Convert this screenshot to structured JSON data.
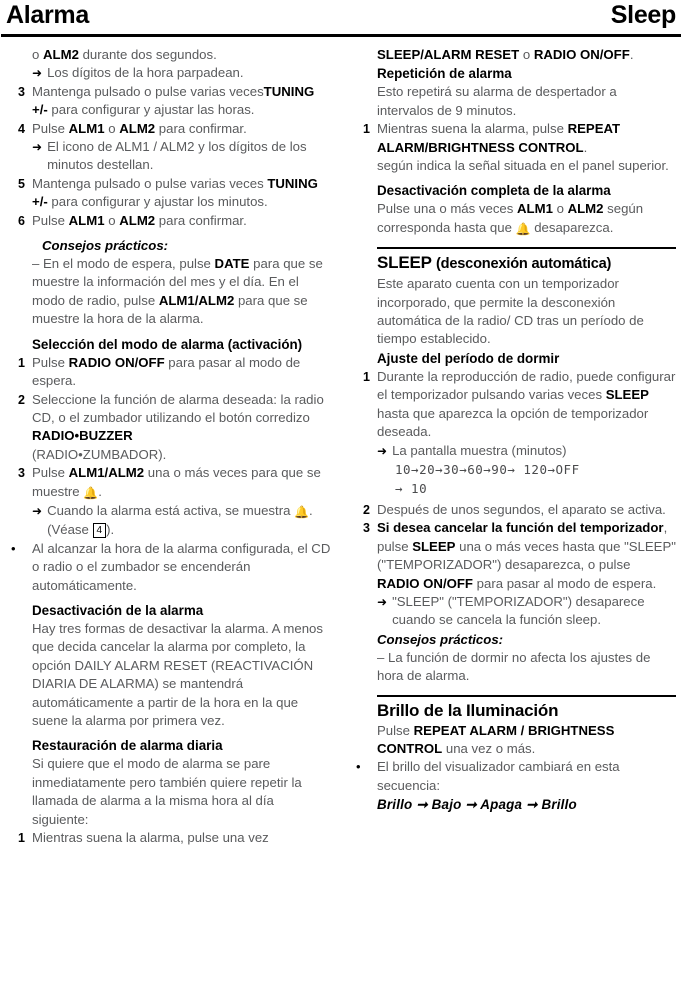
{
  "header": {
    "left_title": "Alarma",
    "right_title": "Sleep"
  },
  "left_column": {
    "item_cont_1": {
      "text_pre": "o ",
      "bold": "ALM2",
      "text_post": " durante dos segundos."
    },
    "arrow_1": "Los dígitos de la hora parpadean.",
    "step_3": {
      "num": "3",
      "text_1": "Mantenga pulsado o pulse varias veces",
      "bold_1": "TUNING +/-",
      "text_2": " para configurar y ajustar las horas."
    },
    "step_4": {
      "num": "4",
      "text_1": "Pulse ",
      "bold_1": "ALM1",
      "text_2": " o ",
      "bold_2": "ALM2",
      "text_3": " para confirmar."
    },
    "arrow_2": "El icono de ALM1 / ALM2 y los dígitos de los minutos destellan.",
    "step_5": {
      "num": "5",
      "text_1": "Mantenga pulsado o pulse varias veces ",
      "bold_1": "TUNING +/-",
      "text_2": " para configurar y ajustar los minutos."
    },
    "step_6": {
      "num": "6",
      "text_1": "Pulse ",
      "bold_1": "ALM1",
      "text_2": " o ",
      "bold_2": "ALM2",
      "text_3": " para confirmar."
    },
    "tips_title_1": "Consejos prácticos:",
    "tips_body_1": {
      "text_1": "– En el modo de espera, pulse ",
      "bold_1": "DATE",
      "text_2": " para que se muestre la información del mes y el día. En el modo de radio, pulse ",
      "bold_2": "ALM1/ALM2",
      "text_3": " para que se muestre la hora de la alarma."
    },
    "heading_seleccion": "Selección del modo de alarma (activación)",
    "step_s1": {
      "num": "1",
      "text_1": "Pulse ",
      "bold_1": "RADIO ON/OFF",
      "text_2": " para pasar al modo de espera."
    },
    "step_s2": {
      "num": "2",
      "text_1": "Seleccione la función de alarma deseada: la radio CD, o el zumbador utilizando el botón corredizo ",
      "bold_1": "RADIO•BUZZER",
      "text_2": " (RADIO•ZUMBADOR)."
    },
    "step_s3": {
      "num": "3",
      "text_1": "Pulse ",
      "bold_1": "ALM1/ALM2",
      "text_2": " una o más veces para que se muestre ",
      "icon": "bell-icon",
      "text_3": "."
    },
    "arrow_s3": {
      "text_1": "Cuando la alarma está activa, se muestra ",
      "icon": "bell-icon",
      "text_2": ". (Véase ",
      "boxnum": "4",
      "text_3": ")."
    },
    "bullet_s": {
      "marker": "•",
      "text": "Al alcanzar la hora de la alarma configurada, el CD o radio o el zumbador se encenderán automáticamente."
    },
    "heading_desactivacion": "Desactivación de la alarma",
    "body_desactivacion": "Hay tres formas de desactivar la alarma.  A menos que decida cancelar la alarma por completo, la opción DAILY ALARM RESET (REACTIVACIÓN DIARIA DE ALARMA) se mantendrá automáticamente a partir de la hora en la que suene la alarma por primera vez.",
    "heading_restauracion": "Restauración de alarma diaria",
    "body_restauracion": "Si quiere que el modo de alarma se pare inmediatamente pero también quiere repetir la llamada de alarma a la misma hora al día siguiente:",
    "step_r1": {
      "num": "1",
      "text_1": "Mientras suena la alarma, pulse una vez"
    }
  },
  "right_column": {
    "cont_top": {
      "bold_1": "SLEEP/ALARM RESET",
      "text_1": " o ",
      "bold_2": "RADIO ON/OFF",
      "text_2": "."
    },
    "heading_repeticion": "Repetición de alarma",
    "body_repeticion": "Esto repetirá su alarma de despertador a intervalos de 9 minutos.",
    "step_rp1": {
      "num": "1",
      "text_1": "Mientras suena la alarma, pulse ",
      "bold_1": "REPEAT ALARM/BRIGHTNESS CONTROL",
      "text_2": "."
    },
    "body_rp1_cont": "según indica la señal situada en el panel superior.",
    "heading_desact_completa": "Desactivación completa de la alarma",
    "body_desact_completa": {
      "text_1": "Pulse una o más veces ",
      "bold_1": "ALM1",
      "text_2": " o ",
      "bold_2": "ALM2",
      "text_3": " según corresponda hasta que ",
      "icon": "bell-icon",
      "text_4": " desaparezca."
    },
    "heading_sleep_main": "SLEEP ",
    "heading_sleep_sub": "(desconexión automática)",
    "body_sleep": "Este aparato cuenta con un temporizador incorporado, que permite la desconexión automática de la radio/ CD tras un período de tiempo establecido.",
    "heading_ajuste": "Ajuste del período de dormir",
    "step_a1": {
      "num": "1",
      "text_1": "Durante la reproducción de radio, puede configurar el temporizador pulsando varias veces ",
      "bold_1": "SLEEP",
      "text_2": " hasta que aparezca la opción de temporizador deseada."
    },
    "arrow_a1": "La pantalla muestra (minutos)",
    "lcd_sequence_line1": "10→20→30→60→90→ 120→OFF",
    "lcd_sequence_line2": "→ 10",
    "step_a2": {
      "num": "2",
      "text_1": "Después de unos segundos, el aparato se activa."
    },
    "step_a3": {
      "num": "3",
      "bold_1": "Si desea cancelar la función del temporizador",
      "text_1": ", pulse ",
      "bold_2": "SLEEP",
      "text_2": " una o más veces hasta que \"SLEEP\" (\"TEMPORIZADOR\") desaparezca, o pulse ",
      "bold_3": "RADIO ON/OFF",
      "text_3": " para pasar al modo de espera."
    },
    "arrow_a3": "\"SLEEP\" (\"TEMPORIZADOR\") desaparece cuando se cancela la función sleep.",
    "tips_title_2": "Consejos prácticos:",
    "tips_body_2": "– La función de dormir no afecta los ajustes de hora de alarma.",
    "heading_brillo": "Brillo de la Iluminación",
    "body_brillo": {
      "text_1": "Pulse ",
      "bold_1": "REPEAT ALARM / BRIGHTNESS CONTROL",
      "text_2": " una vez o más."
    },
    "bullet_brillo": {
      "marker": "•",
      "text": "El brillo del visualizador cambiará en esta secuencia:"
    },
    "brillo_sequence": "Brillo  ➞  Bajo  ➞  Apaga  ➞  Brillo"
  }
}
